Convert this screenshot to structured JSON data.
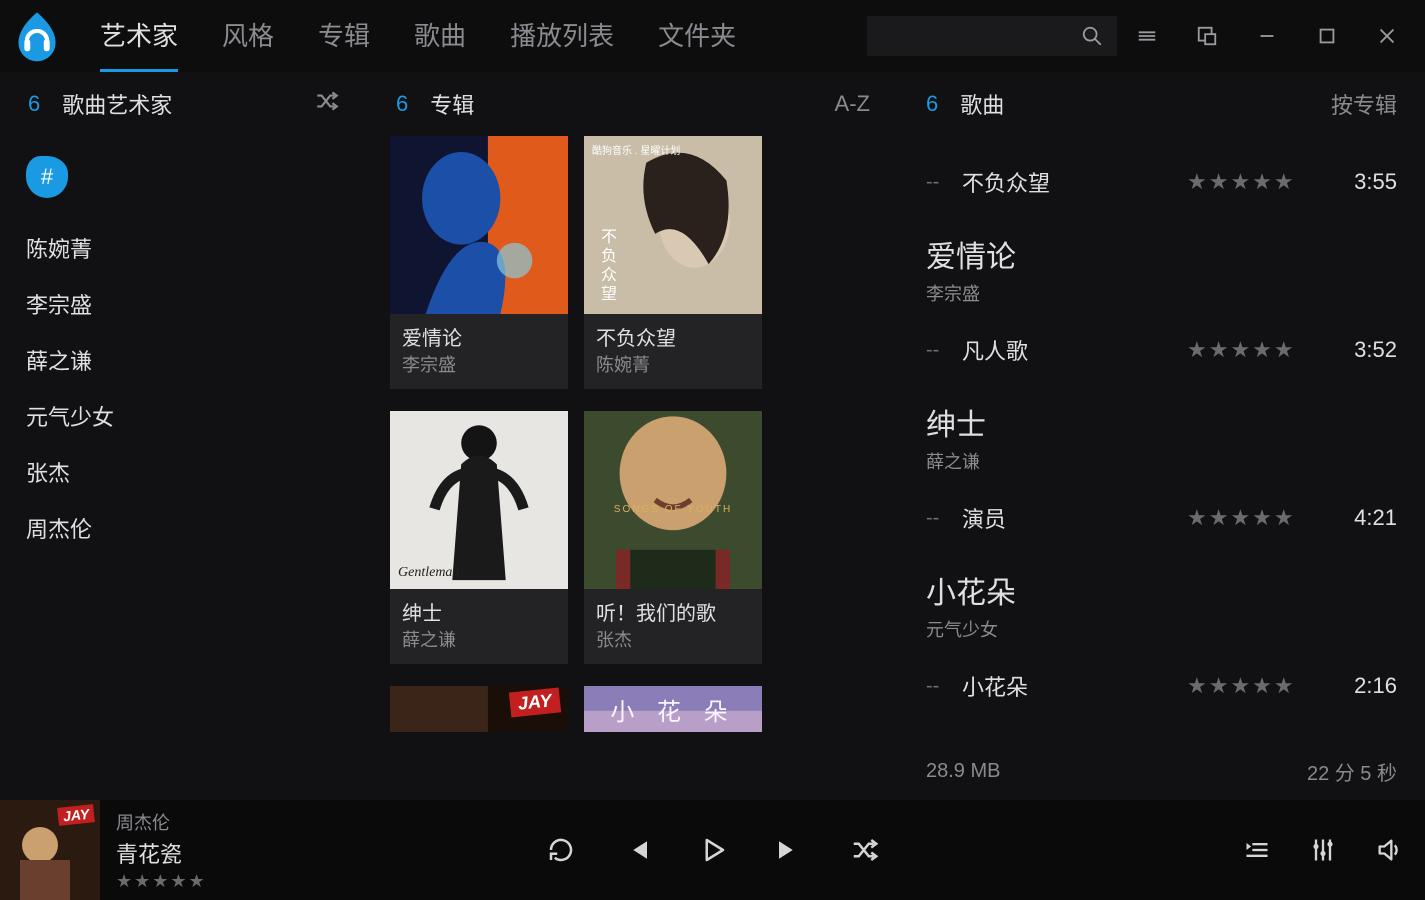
{
  "nav": {
    "tabs": [
      "艺术家",
      "风格",
      "专辑",
      "歌曲",
      "播放列表",
      "文件夹"
    ],
    "active_index": 0
  },
  "artists_panel": {
    "count": "6",
    "title": "歌曲艺术家",
    "hash_label": "#",
    "items": [
      "陈婉菁",
      "李宗盛",
      "薛之谦",
      "元气少女",
      "张杰",
      "周杰伦"
    ]
  },
  "albums_panel": {
    "count": "6",
    "title": "专辑",
    "sort": "A-Z",
    "albums": [
      {
        "title": "爱情论",
        "artist": "李宗盛",
        "art": "blue-orange-figure"
      },
      {
        "title": "不负众望",
        "artist": "陈婉菁",
        "art": "girl-portrait",
        "overlay_top": "酷狗音乐 . 星曜计划",
        "overlay_bottom": "不负众望"
      },
      {
        "title": "绅士",
        "artist": "薛之谦",
        "art": "gentleman-bw",
        "overlay_bottom": "Gentleman"
      },
      {
        "title": "听！我们的歌",
        "artist": "张杰",
        "art": "songs-of-youth",
        "overlay_mid": "SONGS OF YOUTH"
      },
      {
        "title": "",
        "artist": "",
        "art": "jay",
        "partial": true,
        "overlay_badge": "JAY"
      },
      {
        "title": "",
        "artist": "",
        "art": "xiaohuaduo",
        "partial": true,
        "overlay_text": "小 花 朵"
      }
    ]
  },
  "songs_panel": {
    "count": "6",
    "title": "歌曲",
    "sort": "按专辑",
    "groups": [
      {
        "heading": null,
        "tracks": [
          {
            "title": "不负众望",
            "duration": "3:55"
          }
        ]
      },
      {
        "heading": {
          "title": "爱情论",
          "artist": "李宗盛"
        },
        "tracks": [
          {
            "title": "凡人歌",
            "duration": "3:52"
          }
        ]
      },
      {
        "heading": {
          "title": "绅士",
          "artist": "薛之谦"
        },
        "tracks": [
          {
            "title": "演员",
            "duration": "4:21"
          }
        ]
      },
      {
        "heading": {
          "title": "小花朵",
          "artist": "元气少女"
        },
        "tracks": [
          {
            "title": "小花朵",
            "duration": "2:16"
          }
        ]
      }
    ],
    "footer": {
      "size": "28.9 MB",
      "total": "22 分 5 秒"
    },
    "dash": "--",
    "stars": "★★★★★"
  },
  "now_playing": {
    "artist": "周杰伦",
    "title": "青花瓷",
    "stars": "★★★★★",
    "art_badge": "JAY"
  }
}
